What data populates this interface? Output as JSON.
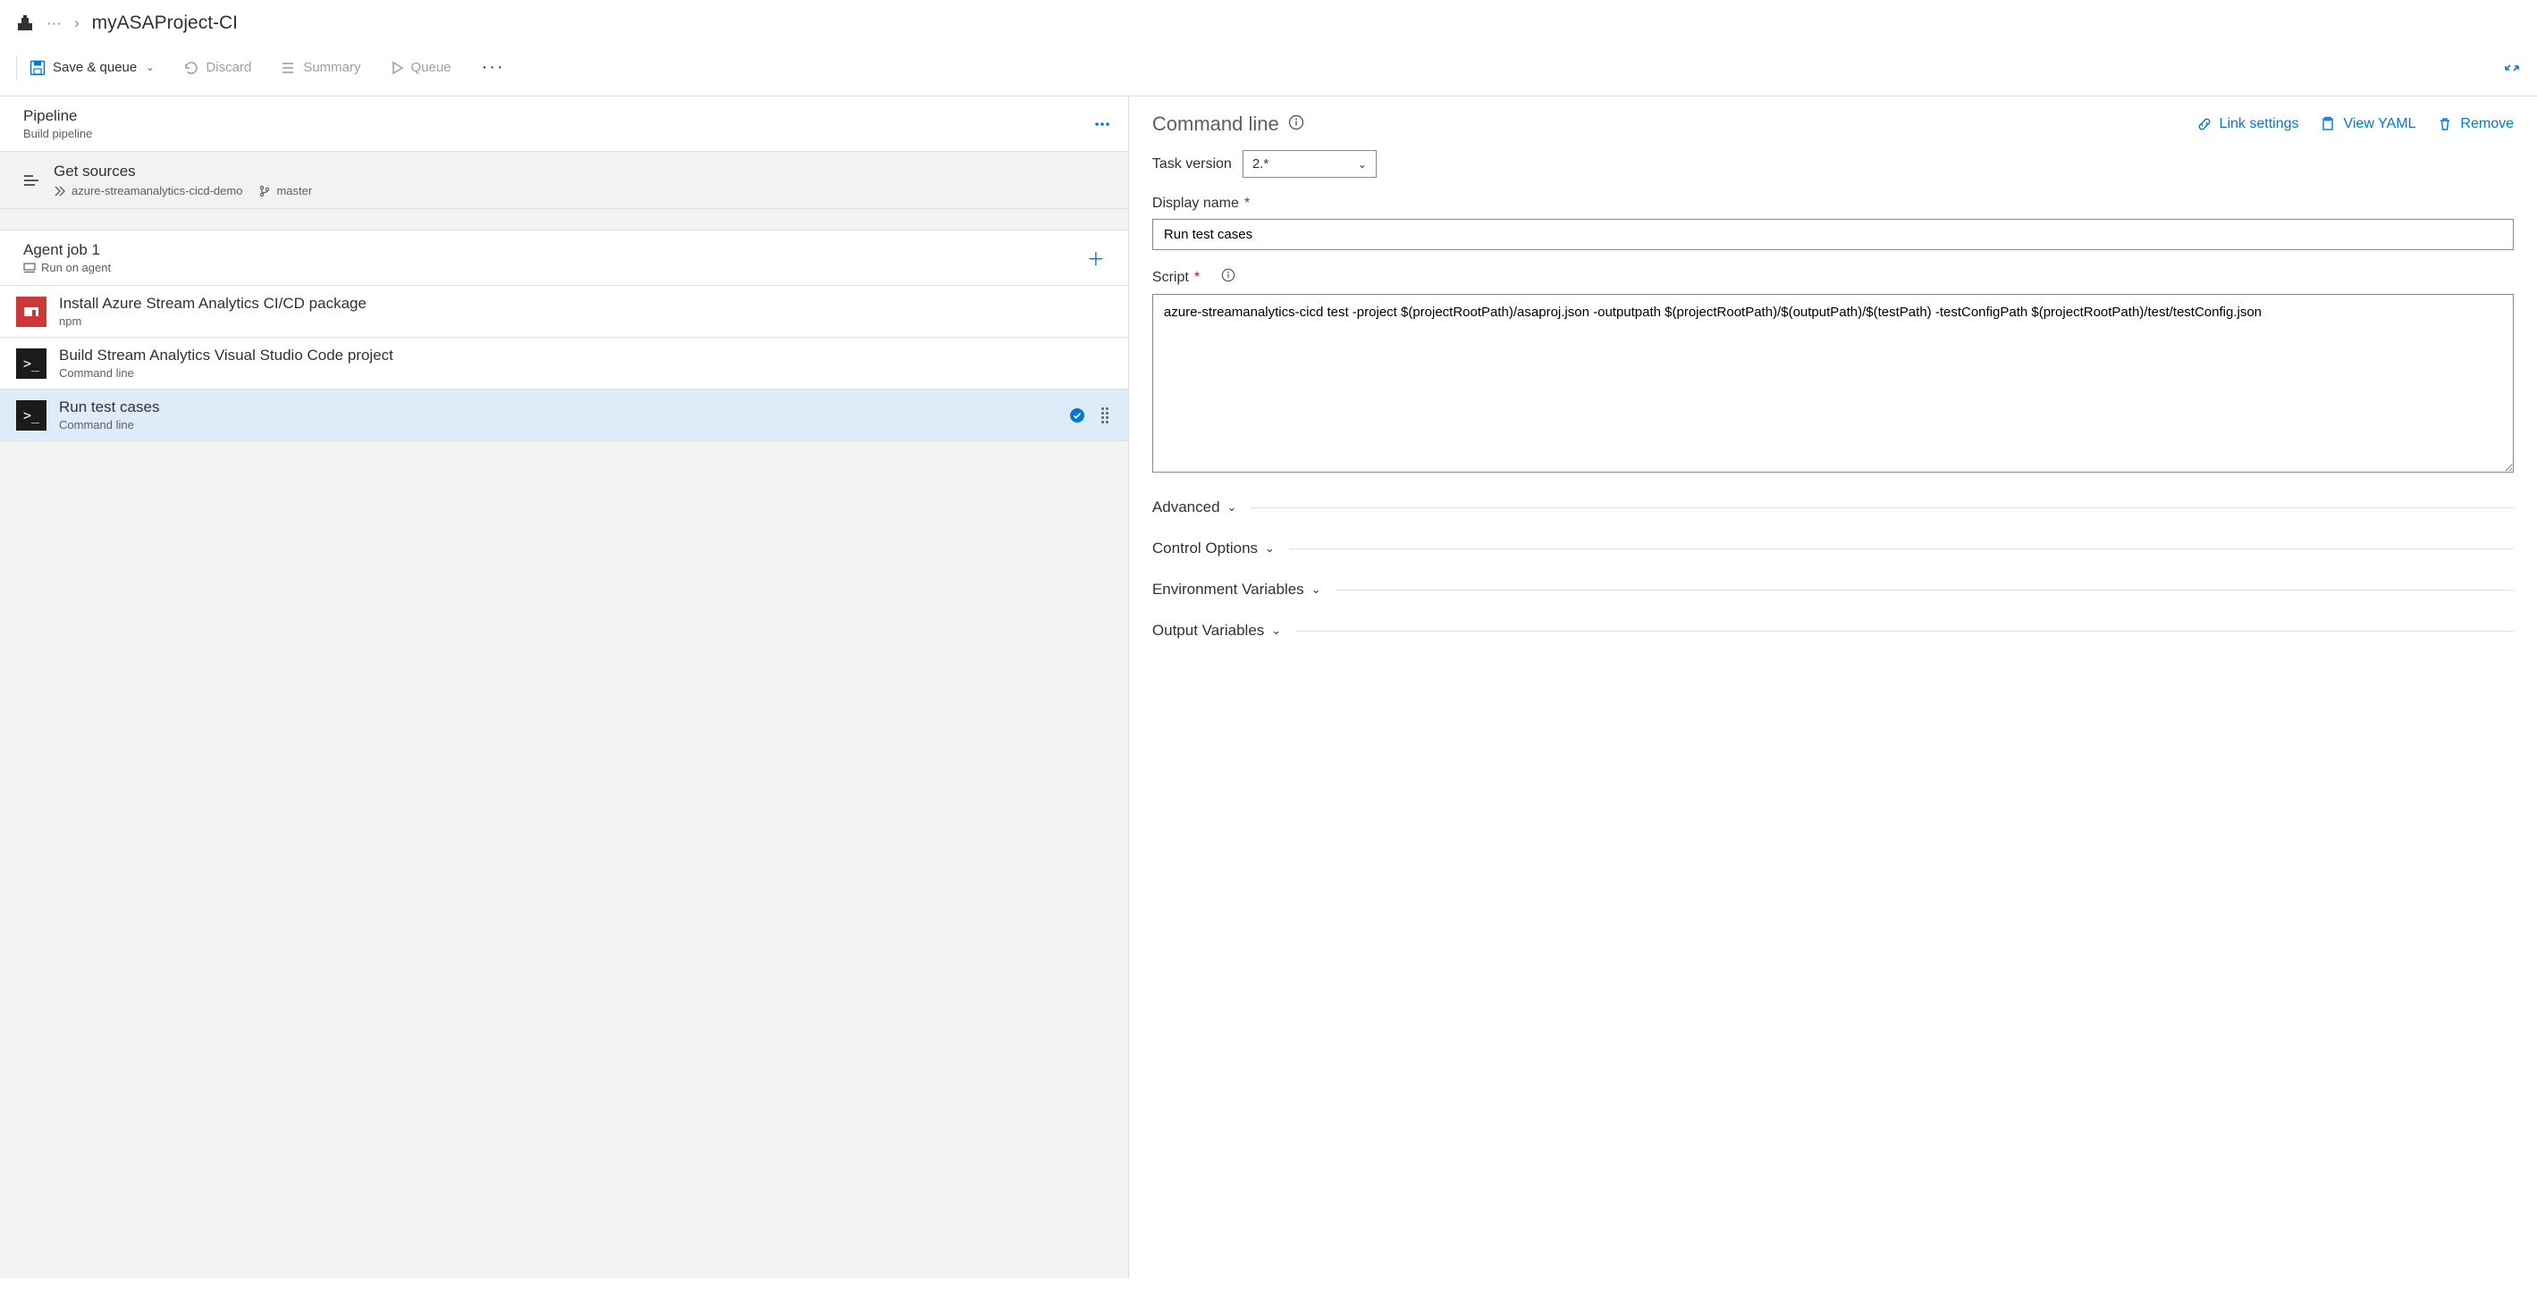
{
  "breadcrumb": {
    "title": "myASAProject-CI",
    "ellipsis": "···"
  },
  "toolbar": {
    "save_queue": "Save & queue",
    "discard": "Discard",
    "summary": "Summary",
    "queue": "Queue",
    "more": "···"
  },
  "left": {
    "pipeline": {
      "title": "Pipeline",
      "sub": "Build pipeline"
    },
    "sources": {
      "title": "Get sources",
      "repo": "azure-streamanalytics-cicd-demo",
      "branch": "master"
    },
    "agent": {
      "title": "Agent job 1",
      "sub": "Run on agent"
    },
    "tasks": [
      {
        "title": "Install Azure Stream Analytics CI/CD package",
        "sub": "npm",
        "icon": "npm"
      },
      {
        "title": "Build Stream Analytics Visual Studio Code project",
        "sub": "Command line",
        "icon": "term"
      },
      {
        "title": "Run test cases",
        "sub": "Command line",
        "icon": "term",
        "selected": true
      }
    ]
  },
  "right": {
    "title": "Command line",
    "links": {
      "link_settings": "Link settings",
      "view_yaml": "View YAML",
      "remove": "Remove"
    },
    "task_version": {
      "label": "Task version",
      "value": "2.*"
    },
    "display_name": {
      "label": "Display name",
      "value": "Run test cases"
    },
    "script": {
      "label": "Script",
      "value": "azure-streamanalytics-cicd test -project $(projectRootPath)/asaproj.json -outputpath $(projectRootPath)/$(outputPath)/$(testPath) -testConfigPath $(projectRootPath)/test/testConfig.json"
    },
    "sections": {
      "advanced": "Advanced",
      "control": "Control Options",
      "env": "Environment Variables",
      "output": "Output Variables"
    }
  }
}
